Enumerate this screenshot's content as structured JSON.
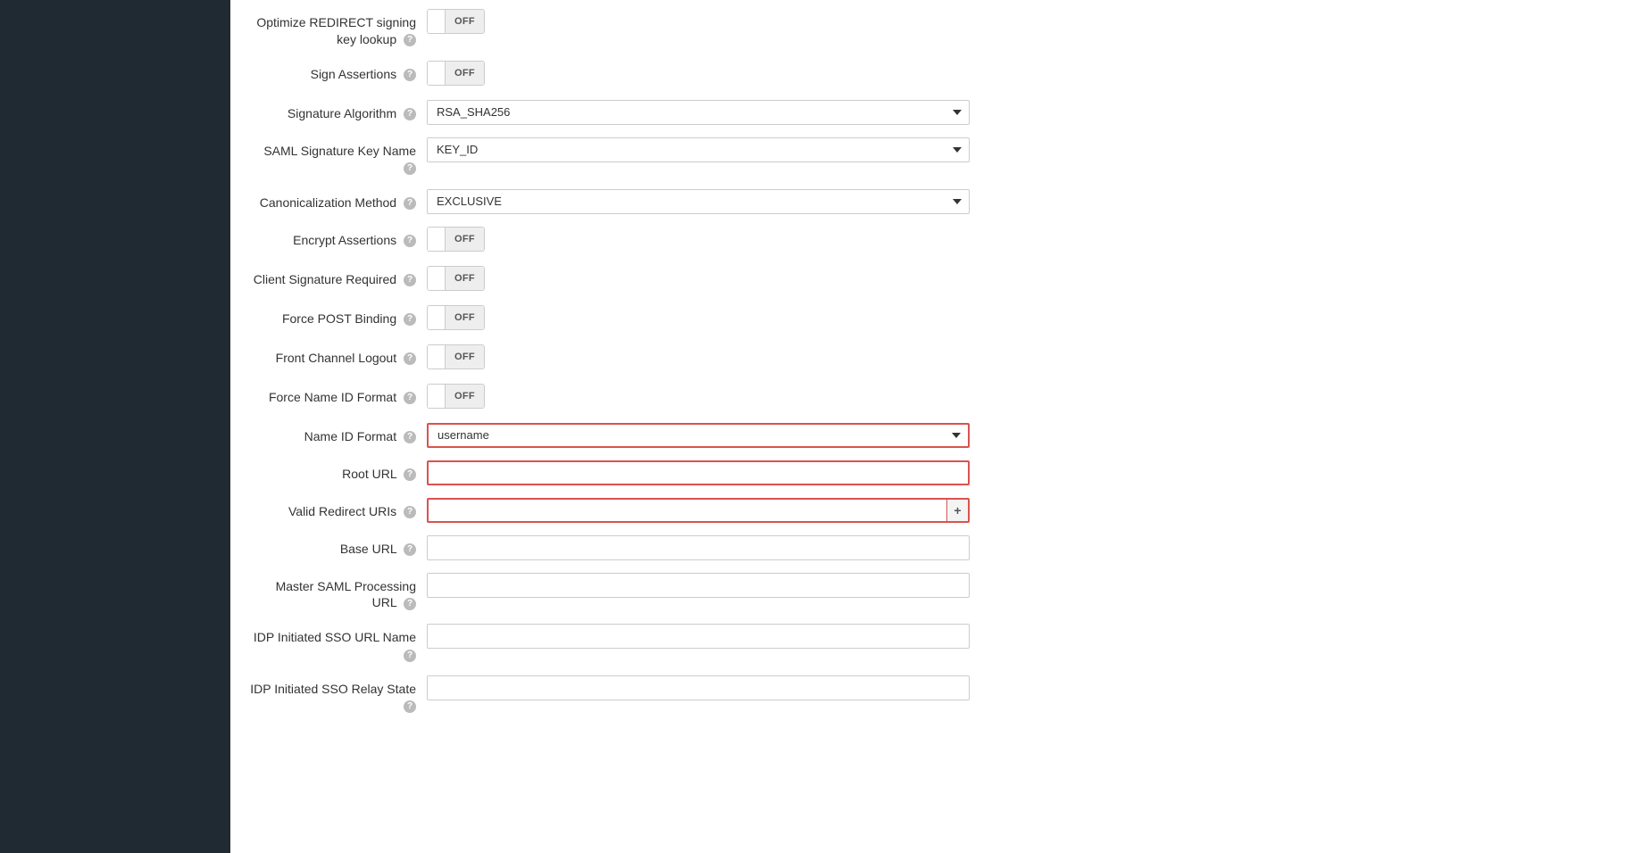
{
  "toggles": {
    "off_label": "OFF"
  },
  "fields": {
    "optimize_redirect": {
      "label": "Optimize REDIRECT signing key lookup"
    },
    "sign_assertions": {
      "label": "Sign Assertions"
    },
    "sig_algo": {
      "label": "Signature Algorithm",
      "value": "RSA_SHA256"
    },
    "saml_sig_key_name": {
      "label": "SAML Signature Key Name",
      "value": "KEY_ID"
    },
    "canon_method": {
      "label": "Canonicalization Method",
      "value": "EXCLUSIVE"
    },
    "encrypt_assertions": {
      "label": "Encrypt Assertions"
    },
    "client_sig_required": {
      "label": "Client Signature Required"
    },
    "force_post_binding": {
      "label": "Force POST Binding"
    },
    "front_channel_logout": {
      "label": "Front Channel Logout"
    },
    "force_name_id_format": {
      "label": "Force Name ID Format"
    },
    "name_id_format": {
      "label": "Name ID Format",
      "value": "username"
    },
    "root_url": {
      "label": "Root URL",
      "value": ""
    },
    "valid_redirect_uris": {
      "label": "Valid Redirect URIs",
      "value": ""
    },
    "base_url": {
      "label": "Base URL",
      "value": ""
    },
    "master_saml_url": {
      "label": "Master SAML Processing URL",
      "value": ""
    },
    "idp_sso_url_name": {
      "label": "IDP Initiated SSO URL Name",
      "value": ""
    },
    "idp_sso_relay_state": {
      "label": "IDP Initiated SSO Relay State",
      "value": ""
    }
  }
}
